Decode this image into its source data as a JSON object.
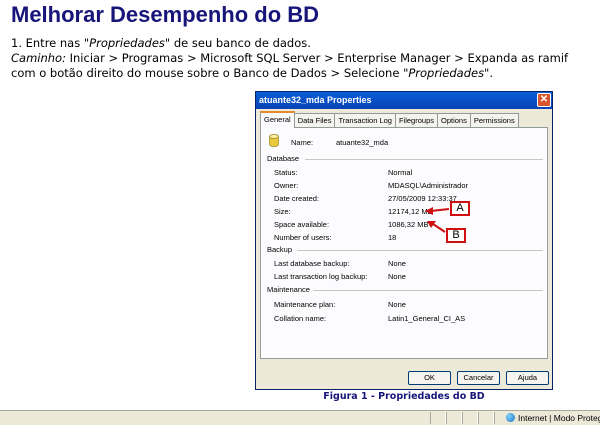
{
  "heading": "Melhorar Desempenho do BD",
  "intro": {
    "line1_prefix": "1. Entre nas ",
    "line1_italic": "\"Propriedades\"",
    "line1_suffix": " de seu banco de dados.",
    "line2_italic": "Caminho:",
    "line2_rest": " Iniciar > Programas > Microsoft SQL Server > Enterprise Manager > Expanda as ramif",
    "line3_prefix": "com o botão direito do mouse sobre o Banco de Dados > Selecione ",
    "line3_italic": "\"Propriedades\"",
    "line3_suffix": "."
  },
  "dialog": {
    "title": "atuante32_mda Properties",
    "close_glyph": "✕",
    "tabs": [
      "General",
      "Data Files",
      "Transaction Log",
      "Filegroups",
      "Options",
      "Permissions"
    ],
    "name_label": "Name:",
    "name_value": "atuante32_mda",
    "sections": {
      "database": "Database",
      "backup": "Backup",
      "maintenance": "Maintenance"
    },
    "database_rows": [
      {
        "label": "Status:",
        "value": "Normal"
      },
      {
        "label": "Owner:",
        "value": "MDASQL\\Administrador"
      },
      {
        "label": "Date created:",
        "value": "27/05/2009 12:33:37"
      },
      {
        "label": "Size:",
        "value": "12174,12 MB"
      },
      {
        "label": "Space available:",
        "value": "1086,32 MB"
      },
      {
        "label": "Number of users:",
        "value": "18"
      }
    ],
    "backup_rows": [
      {
        "label": "Last database backup:",
        "value": "None"
      },
      {
        "label": "Last transaction log backup:",
        "value": "None"
      }
    ],
    "maintenance_rows": [
      {
        "label": "Maintenance plan:",
        "value": "None"
      },
      {
        "label": "Collation name:",
        "value": "Latin1_General_CI_AS"
      }
    ],
    "buttons": {
      "ok": "OK",
      "cancel": "Cancelar",
      "help": "Ajuda"
    }
  },
  "callouts": {
    "a": "A",
    "b": "B",
    "color": "#d01010"
  },
  "caption": "Figura 1 - Propriedades do BD",
  "statusbar": {
    "zone": "Internet | Modo Proteg"
  },
  "colors": {
    "heading": "#17157a",
    "dialog_bg": "#ece9d8",
    "titlebar": "#0a5fd8"
  }
}
